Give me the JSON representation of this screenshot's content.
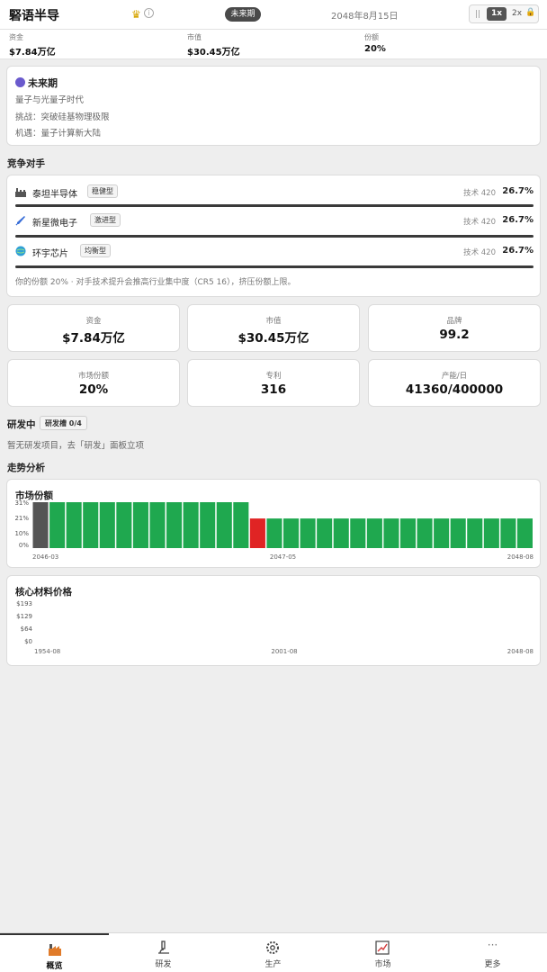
{
  "header": {
    "title": "硻语半导",
    "era_badge": "未来期",
    "date": "2048年8月15日",
    "speed": {
      "pause": "||",
      "x1": "1x",
      "x2": "2x"
    }
  },
  "stats": [
    {
      "label": "资金",
      "value": "$7.84万亿"
    },
    {
      "label": "市值",
      "value": "$30.45万亿"
    },
    {
      "label": "份额",
      "value": "20%"
    }
  ],
  "era": {
    "title": "未来期",
    "lines": [
      "量子与光量子时代",
      "挑战：突破硅基物理极限",
      "机遇：量子计算新大陆"
    ]
  },
  "competitors_title": "竞争对手",
  "competitors": [
    {
      "name": "泰坦半导体",
      "tag": "稳健型",
      "tech": "技术 420",
      "share": "26.7%",
      "icon": "factory-icon"
    },
    {
      "name": "新星微电子",
      "tag": "激进型",
      "tech": "技术 420",
      "share": "26.7%",
      "icon": "rocket-icon"
    },
    {
      "name": "环宇芯片",
      "tag": "均衡型",
      "tech": "技术 420",
      "share": "26.7%",
      "icon": "globe-icon"
    }
  ],
  "competitor_note": "你的份额 20% · 对手技术提升会推高行业集中度（CR5 16），挤压份额上限。",
  "metrics": [
    {
      "label": "资金",
      "value": "$7.84万亿"
    },
    {
      "label": "市值",
      "value": "$30.45万亿"
    },
    {
      "label": "品牌",
      "value": "99.2"
    },
    {
      "label": "市场份额",
      "value": "20%"
    },
    {
      "label": "专利",
      "value": "316"
    },
    {
      "label": "产能/日",
      "value": "41360/400000"
    }
  ],
  "rd": {
    "title": "研发中",
    "slot": "研发槽 0/4",
    "empty": "暂无研发项目，去「研发」面板立项"
  },
  "trend_title": "走势分析",
  "chart_data": [
    {
      "type": "bar",
      "title": "市场份额",
      "yticks": [
        "31%",
        "21%",
        "10%",
        "0%"
      ],
      "ylim": [
        0,
        31
      ],
      "xticks": [
        "2046-03",
        "2047-05",
        "2048-08"
      ],
      "values": [
        31,
        31,
        31,
        31,
        31,
        31,
        31,
        31,
        31,
        31,
        31,
        31,
        31,
        20,
        20,
        20,
        20,
        20,
        20,
        20,
        20,
        20,
        20,
        20,
        20,
        20,
        20,
        20,
        20,
        20
      ],
      "colors": {
        "neutral": "#555555",
        "positive": "#1fa84f",
        "negative": "#e02424"
      }
    },
    {
      "type": "line",
      "title": "核心材料价格",
      "yticks": [
        "$193",
        "$129",
        "$64",
        "$0"
      ],
      "xticks": [
        "1954-08",
        "2001-08",
        "2048-08"
      ],
      "values": []
    }
  ],
  "nav": [
    {
      "label": "概览",
      "icon": "factory-icon",
      "active": true
    },
    {
      "label": "研发",
      "icon": "microscope-icon"
    },
    {
      "label": "生产",
      "icon": "gear-icon"
    },
    {
      "label": "市场",
      "icon": "chart-icon"
    },
    {
      "label": "更多",
      "icon": "more-icon"
    }
  ]
}
